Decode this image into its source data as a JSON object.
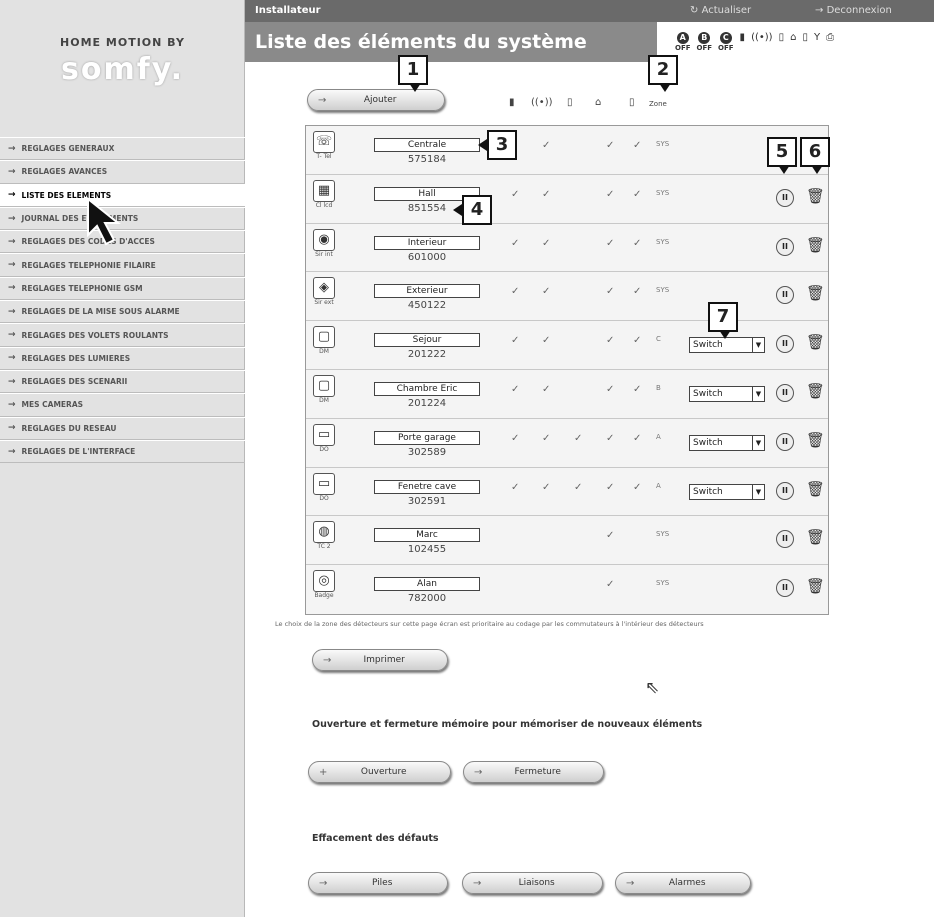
{
  "sidebar": {
    "brand_line": "HOME MOTION BY",
    "brand_logo": "somfy.",
    "menu": [
      {
        "label": "REGLAGES GENERAUX"
      },
      {
        "label": "REGLAGES AVANCES"
      },
      {
        "label": "LISTE DES ELEMENTS",
        "active": true
      },
      {
        "label": "JOURNAL DES EVENEMENTS"
      },
      {
        "label": "REGLAGES DES CODES D'ACCES"
      },
      {
        "label": "REGLAGES TELEPHONIE FILAIRE"
      },
      {
        "label": "REGLAGES TELEPHONIE GSM"
      },
      {
        "label": "REGLAGES DE LA MISE SOUS ALARME"
      },
      {
        "label": "REGLAGES DES VOLETS ROULANTS"
      },
      {
        "label": "REGLAGES DES LUMIERES"
      },
      {
        "label": "REGLAGES DES SCENARII"
      },
      {
        "label": "MES CAMERAS"
      },
      {
        "label": "REGLAGES DU RESEAU"
      },
      {
        "label": "REGLAGES DE L'INTERFACE"
      }
    ]
  },
  "topbar": {
    "role": "Installateur",
    "refresh": "Actualiser",
    "logout": "Deconnexion"
  },
  "page_title": "Liste des éléments du système",
  "status": [
    {
      "letter": "A",
      "state": "OFF"
    },
    {
      "letter": "B",
      "state": "OFF"
    },
    {
      "letter": "C",
      "state": "OFF"
    }
  ],
  "add_button": "Ajouter",
  "columns": {
    "zone": "Zone"
  },
  "rows": [
    {
      "name": "Centrale",
      "id": "575184",
      "type": "T- Tel",
      "checks": [
        false,
        true,
        false,
        true,
        true
      ],
      "zone": "SYS",
      "mode": null,
      "icon": "phone-icon"
    },
    {
      "name": "Hall",
      "id": "851554",
      "type": "Cl lcd",
      "checks": [
        true,
        true,
        false,
        true,
        true
      ],
      "zone": "SYS",
      "mode": null,
      "icon": "keypad-icon"
    },
    {
      "name": "Interieur",
      "id": "601000",
      "type": "Sir int",
      "checks": [
        true,
        true,
        false,
        true,
        true
      ],
      "zone": "SYS",
      "mode": null,
      "icon": "siren-icon"
    },
    {
      "name": "Exterieur",
      "id": "450122",
      "type": "Sir ext",
      "checks": [
        true,
        true,
        false,
        true,
        true
      ],
      "zone": "SYS",
      "mode": null,
      "icon": "outdoor-siren-icon"
    },
    {
      "name": "Sejour",
      "id": "201222",
      "type": "DM",
      "checks": [
        true,
        true,
        false,
        true,
        true
      ],
      "zone": "C",
      "mode": "Switch",
      "icon": "motion-detector-icon"
    },
    {
      "name": "Chambre Eric",
      "id": "201224",
      "type": "DM",
      "checks": [
        true,
        true,
        false,
        true,
        true
      ],
      "zone": "B",
      "mode": "Switch",
      "icon": "motion-detector-icon"
    },
    {
      "name": "Porte garage",
      "id": "302589",
      "type": "DO",
      "checks": [
        true,
        true,
        true,
        true,
        true
      ],
      "zone": "A",
      "mode": "Switch",
      "icon": "door-sensor-icon"
    },
    {
      "name": "Fenetre cave",
      "id": "302591",
      "type": "DO",
      "checks": [
        true,
        true,
        true,
        true,
        true
      ],
      "zone": "A",
      "mode": "Switch",
      "icon": "door-sensor-icon"
    },
    {
      "name": "Marc",
      "id": "102455",
      "type": "TC 2",
      "checks": [
        false,
        false,
        false,
        true,
        false
      ],
      "zone": "SYS",
      "mode": null,
      "icon": "remote-icon"
    },
    {
      "name": "Alan",
      "id": "782000",
      "type": "Badge",
      "checks": [
        false,
        false,
        false,
        true,
        false
      ],
      "zone": "SYS",
      "mode": null,
      "icon": "badge-icon"
    }
  ],
  "check_glyph": "✓",
  "note": "Le choix de la zone des détecteurs sur cette page écran est prioritaire au codage par les commutateurs à l'intérieur des détecteurs",
  "print_button": "Imprimer",
  "learn_section": {
    "title": "Ouverture et fermeture mémoire pour mémoriser de nouveaux éléments",
    "open": "Ouverture",
    "close": "Fermeture"
  },
  "clear_section": {
    "title": "Effacement des défauts",
    "batteries": "Piles",
    "links": "Liaisons",
    "alarms": "Alarmes"
  },
  "callouts": [
    "1",
    "2",
    "3",
    "4",
    "5",
    "6",
    "7"
  ]
}
